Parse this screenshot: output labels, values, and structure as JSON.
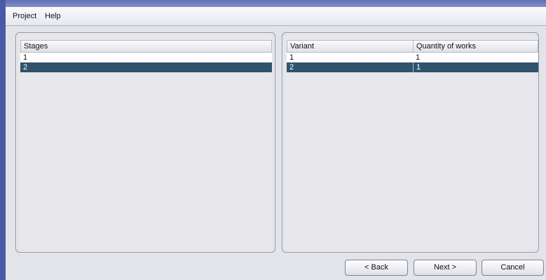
{
  "menu": {
    "items": [
      {
        "label": "Project"
      },
      {
        "label": "Help"
      }
    ]
  },
  "stages_table": {
    "columns": [
      "Stages"
    ],
    "rows": [
      {
        "values": [
          "1"
        ],
        "selected": false
      },
      {
        "values": [
          "2"
        ],
        "selected": true
      }
    ]
  },
  "variants_table": {
    "columns": [
      "Variant",
      "Quantity of works"
    ],
    "rows": [
      {
        "values": [
          "1",
          "1"
        ],
        "selected": false
      },
      {
        "values": [
          "2",
          "1"
        ],
        "selected": true
      }
    ]
  },
  "buttons": {
    "back_label": "< Back",
    "next_label": "Next >",
    "cancel_label": "Cancel"
  },
  "colors": {
    "selection": "#2f536c",
    "window_background": "#e3e4ea",
    "desktop": "#4a5aa6"
  }
}
